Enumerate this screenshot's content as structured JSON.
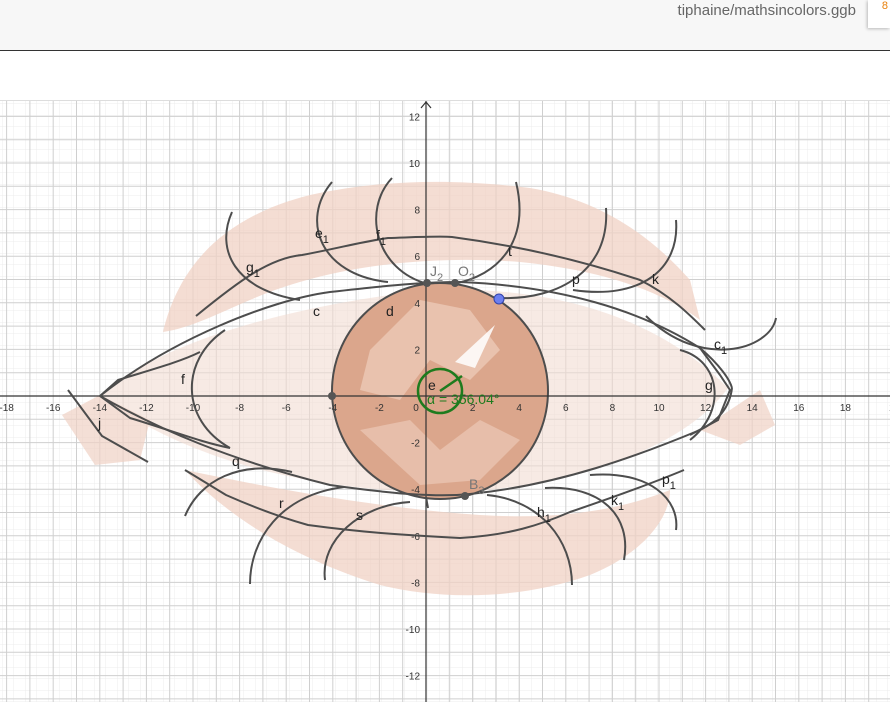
{
  "header": {
    "file_title": "tiphaine/mathsincolors.ggb",
    "corner_chip": "8"
  },
  "axes": {
    "x_ticks": [
      "-18",
      "-16",
      "-14",
      "-12",
      "-10",
      "-8",
      "-6",
      "-4",
      "-2",
      "0",
      "2",
      "4",
      "6",
      "8",
      "10",
      "12",
      "14",
      "16",
      "18",
      "2"
    ],
    "y_ticks": [
      "12",
      "10",
      "8",
      "6",
      "4",
      "2",
      "-2",
      "-4",
      "-6",
      "-8",
      "-10",
      "-12"
    ]
  },
  "objects": {
    "labels": {
      "e1": "e",
      "e1_sub": "1",
      "f1": "f",
      "f1_sub": "1",
      "g1": "g",
      "g1_sub": "1",
      "t": "t",
      "J2": "J",
      "J2_sub": "2",
      "O2": "O",
      "O2_sub": "2",
      "p": "p",
      "k": "k",
      "c": "c",
      "d": "d",
      "c1": "c",
      "c1_sub": "1",
      "f": "f",
      "g": "g",
      "j": "j",
      "e": "e",
      "angle": "α = 356.04°",
      "q": "q",
      "r": "r",
      "s": "s",
      "B3": "B",
      "B3_sub": "3",
      "h1": "h",
      "h1_sub": "1",
      "k1": "k",
      "k1_sub": "1",
      "p1": "p",
      "p1_sub": "1"
    }
  },
  "colors": {
    "iris_fill": "#dba68c",
    "shadow_fill": "#f0d2c4",
    "curve_stroke": "#4d4d4d",
    "angle_green": "#1e7b1e",
    "point_blue": "#6c7ff0",
    "point_gray": "#555555"
  }
}
